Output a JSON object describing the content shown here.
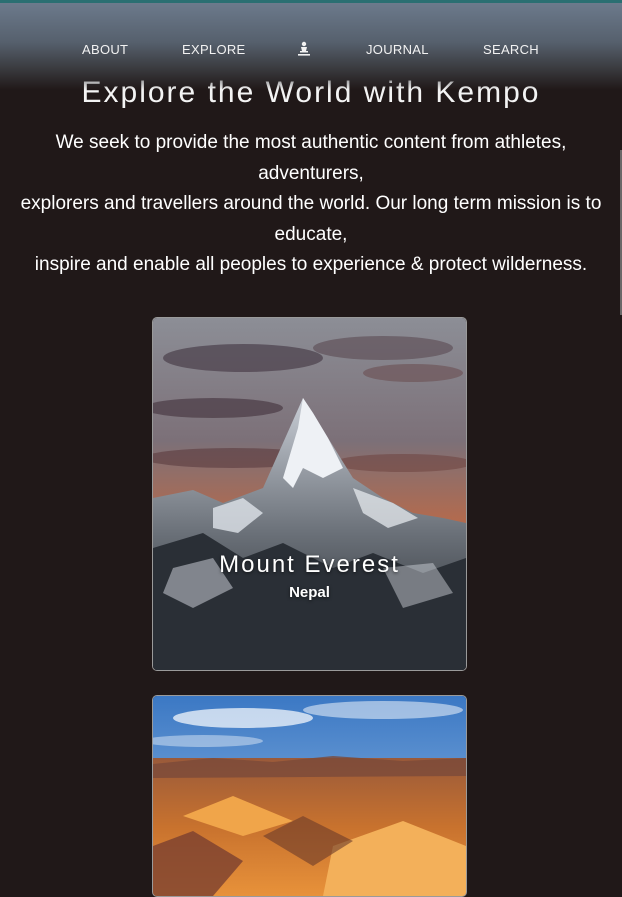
{
  "nav": {
    "about": "ABOUT",
    "explore": "EXPLORE",
    "logo_icon": "hiker-logo-icon",
    "journal": "JOURNAL",
    "search": "SEARCH"
  },
  "hero": {
    "title": "Explore the World with Kempo",
    "lines": [
      "We seek to provide the most authentic content from athletes,",
      "adventurers,",
      "explorers and travellers around the world. Our long term mission is to",
      "educate,",
      "inspire and enable all peoples to experience & protect wilderness."
    ]
  },
  "cards": [
    {
      "title": "Mount Everest",
      "subtitle": "Nepal"
    }
  ],
  "colors": {
    "background": "#201818",
    "accent": "#2a6f72",
    "text": "#ffffff"
  }
}
